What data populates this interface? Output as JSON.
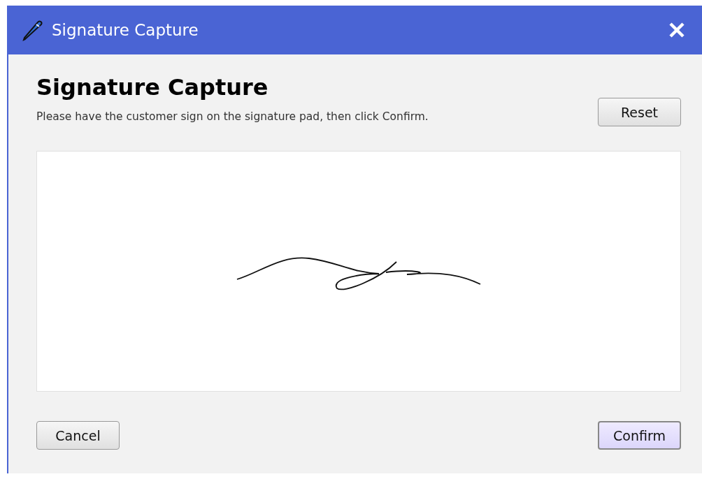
{
  "window": {
    "title": "Signature Capture"
  },
  "heading": "Signature Capture",
  "instructions": "Please have the customer sign on the signature pad, then click Confirm.",
  "reset_button": {
    "label": "Reset",
    "default": false
  },
  "signature_pad": {
    "signed": true
  },
  "buttons": [
    {
      "label": "Cancel",
      "default": false
    },
    {
      "label": "Confirm",
      "default": true
    }
  ]
}
